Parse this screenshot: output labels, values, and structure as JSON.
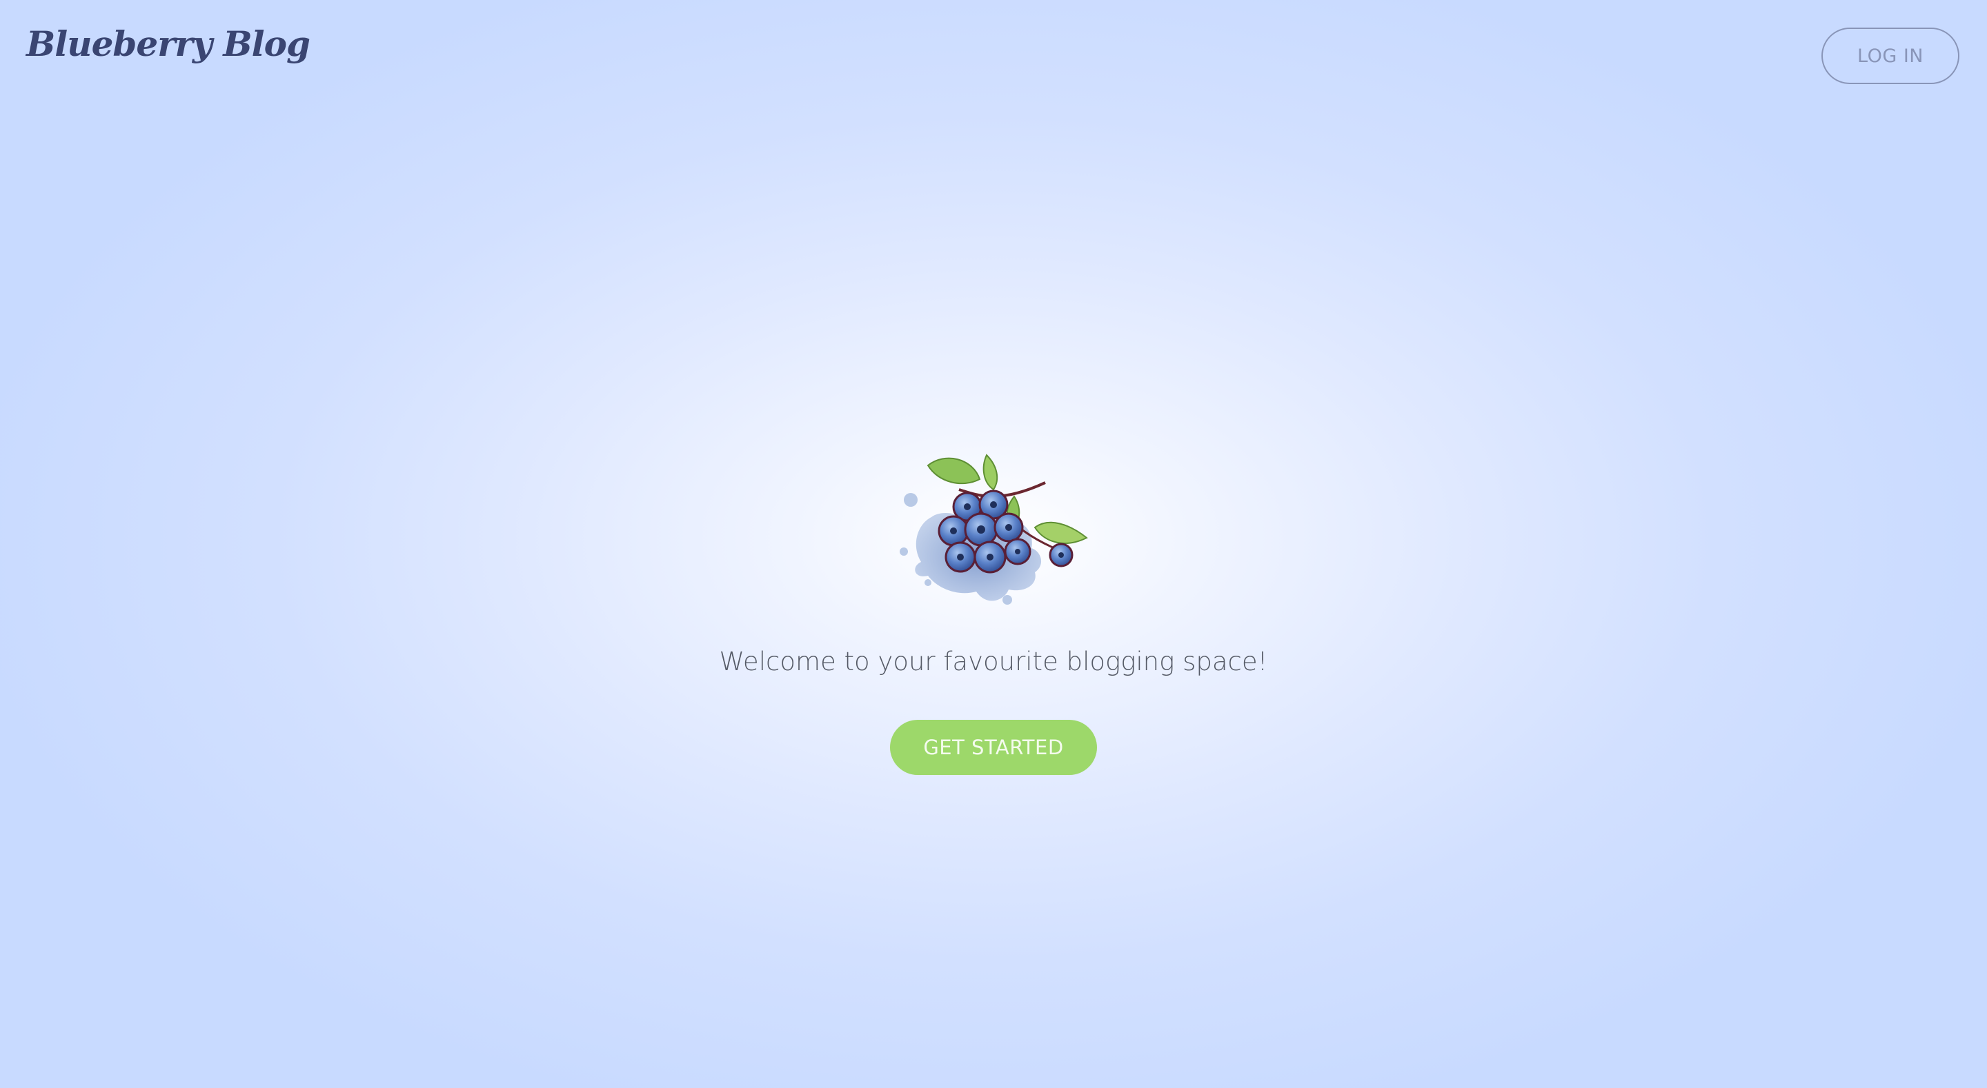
{
  "header": {
    "brand": "Blueberry Blog",
    "login_label": "LOG IN"
  },
  "hero": {
    "image_icon": "blueberry-cluster-icon",
    "welcome_text": "Welcome to your favourite blogging space!",
    "cta_label": "GET STARTED"
  },
  "colors": {
    "background": "#c8daff",
    "brand_text": "#3a4572",
    "cta_green": "#9dd86a",
    "login_outline": "#8995b8",
    "berry_blue": "#4f79c4",
    "leaf_green": "#8cc257"
  }
}
